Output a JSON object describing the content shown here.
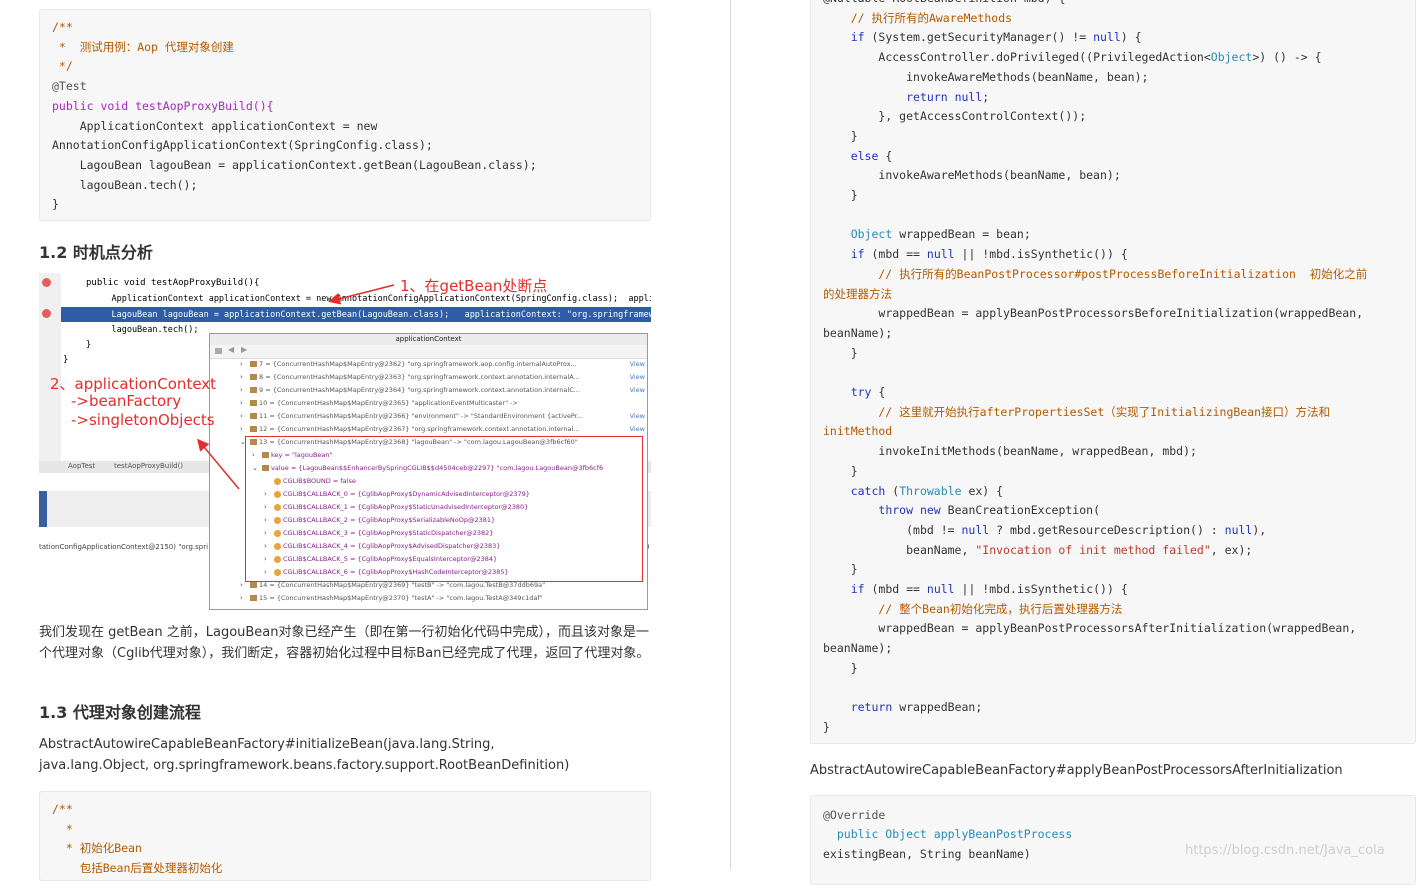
{
  "left": {
    "code1": {
      "lines": [
        "/**",
        " *  测试用例：Aop 代理对象创建",
        " */",
        "@Test",
        "public void testAopProxyBuild(){",
        "    ApplicationContext applicationContext = new",
        "AnnotationConfigApplicationContext(SpringConfig.class);",
        "    LagouBean lagouBean = applicationContext.getBean(LagouBean.class);",
        "    lagouBean.tech();",
        "}"
      ]
    },
    "heading1": "1.2 时机点分析",
    "figure": {
      "ide_lines": [
        "public void testAopProxyBuild(){",
        "    ApplicationContext applicationContext = new AnnotationConfigApplicationContext(SpringConfig.class);  applica",
        "    LagouBean lagouBean = applicationContext.getBean(LagouBean.class);   applicationContext: \"org.springframework",
        "    lagouBean.tech();",
        "  }",
        "}"
      ],
      "status_left": "AopTest",
      "status_right": "testAopProxyBuild()",
      "bottom_text": "tationConfigApplicationContext@2150) \"org.spri",
      "bottom_right": "0",
      "debug_title": "applicationContext",
      "debug_rows": [
        {
          "text": "7 = {ConcurrentHashMap$MapEntry@2362} \"org.springframework.aop.config.internalAutoProx...",
          "view": "View",
          "indent": 0,
          "arrow": ">"
        },
        {
          "text": "8 = {ConcurrentHashMap$MapEntry@2363} \"org.springframework.context.annotation.internalA...",
          "view": "View",
          "indent": 0,
          "arrow": ">"
        },
        {
          "text": "9 = {ConcurrentHashMap$MapEntry@2364} \"org.springframework.context.annotation.internalC...",
          "view": "View",
          "indent": 0,
          "arrow": ">"
        },
        {
          "text": "10 = {ConcurrentHashMap$MapEntry@2365} \"applicationEventMulticaster\" ->",
          "view": "",
          "indent": 0,
          "arrow": ">"
        },
        {
          "text": "11 = {ConcurrentHashMap$MapEntry@2366} \"environment\" -> \"StandardEnvironment {activePr...",
          "view": "View",
          "indent": 0,
          "arrow": ">"
        },
        {
          "text": "12 = {ConcurrentHashMap$MapEntry@2367} \"org.springframework.context.annotation.internal...",
          "view": "View",
          "indent": 0,
          "arrow": ">"
        },
        {
          "text": "13 = {ConcurrentHashMap$MapEntry@2368} \"lagouBean\" -> \"com.lagou.LagouBean@3fb6cf60\"",
          "view": "",
          "indent": 0,
          "arrow": "v"
        },
        {
          "text": "key = \"lagouBean\"",
          "view": "",
          "indent": 1,
          "arrow": ">"
        },
        {
          "text": "value = {LagouBean$$EnhancerBySpringCGLIB$$d4504ceb@2297} \"com.lagou.LagouBean@3fb6cf6",
          "view": "",
          "indent": 1,
          "arrow": "v"
        },
        {
          "text": "CGLIB$BOUND = false",
          "view": "",
          "indent": 2,
          "arrow": ""
        },
        {
          "text": "CGLIB$CALLBACK_0 = {CglibAopProxy$DynamicAdvisedInterceptor@2379}",
          "view": "",
          "indent": 2,
          "arrow": ">"
        },
        {
          "text": "CGLIB$CALLBACK_1 = {CglibAopProxy$StaticUnadvisedInterceptor@2380}",
          "view": "",
          "indent": 2,
          "arrow": ">"
        },
        {
          "text": "CGLIB$CALLBACK_2 = {CglibAopProxy$SerializableNoOp@2381}",
          "view": "",
          "indent": 2,
          "arrow": ">"
        },
        {
          "text": "CGLIB$CALLBACK_3 = {CglibAopProxy$StaticDispatcher@2382}",
          "view": "",
          "indent": 2,
          "arrow": ">"
        },
        {
          "text": "CGLIB$CALLBACK_4 = {CglibAopProxy$AdvisedDispatcher@2383}",
          "view": "",
          "indent": 2,
          "arrow": ">"
        },
        {
          "text": "CGLIB$CALLBACK_5 = {CglibAopProxy$EqualsInterceptor@2384}",
          "view": "",
          "indent": 2,
          "arrow": ">"
        },
        {
          "text": "CGLIB$CALLBACK_6 = {CglibAopProxy$HashCodeInterceptor@2385}",
          "view": "",
          "indent": 2,
          "arrow": ">"
        },
        {
          "text": "14 = {ConcurrentHashMap$MapEntry@2369} \"testB\" -> \"com.lagou.TestB@37ddb69a\"",
          "view": "",
          "indent": 0,
          "arrow": ">"
        },
        {
          "text": "15 = {ConcurrentHashMap$MapEntry@2370} \"testA\" -> \"com.lagou.TestA@349c1daf\"",
          "view": "",
          "indent": 0,
          "arrow": ">"
        }
      ],
      "annotation1": "1、在getBean处断点",
      "annotation2_lines": [
        "2、applicationContext",
        "->beanFactory",
        "->singletonObjects"
      ]
    },
    "paragraph1": "我们发现在 getBean 之前，LagouBean对象已经产生（即在第一行初始化代码中完成），而且该对象是一个代理对象（Cglib代理对象），我们断定，容器初始化过程中目标Ban已经完成了代理，返回了代理对象。",
    "heading2": "1.3 代理对象创建流程",
    "paragraph2": "AbstractAutowireCapableBeanFactory#initializeBean(java.lang.String, java.lang.Object, org.springframework.beans.factory.support.RootBeanDefinition)",
    "code2": {
      "lines": [
        "/**",
        "  *",
        "  * 初始化Bean",
        "    包括Bean后置处理器初始化"
      ]
    }
  },
  "right": {
    "code1": {
      "lines": [
        "@Nullable RootBeanDefinition mbd) {",
        "    // 执行所有的AwareMethods",
        "    if (System.getSecurityManager() != null) {",
        "        AccessController.doPrivileged((PrivilegedAction<Object>) () -> {",
        "            invokeAwareMethods(beanName, bean);",
        "            return null;",
        "        }, getAccessControlContext());",
        "    }",
        "    else {",
        "        invokeAwareMethods(beanName, bean);",
        "    }",
        "",
        "    Object wrappedBean = bean;",
        "    if (mbd == null || !mbd.isSynthetic()) {",
        "        // 执行所有的BeanPostProcessor#postProcessBeforeInitialization  初始化之前",
        "的处理器方法",
        "        wrappedBean = applyBeanPostProcessorsBeforeInitialization(wrappedBean,",
        "beanName);",
        "    }",
        "",
        "    try {",
        "        // 这里就开始执行afterPropertiesSet（实现了InitializingBean接口）方法和",
        "initMethod",
        "        invokeInitMethods(beanName, wrappedBean, mbd);",
        "    }",
        "    catch (Throwable ex) {",
        "        throw new BeanCreationException(",
        "            (mbd != null ? mbd.getResourceDescription() : null),",
        "            beanName, \"Invocation of init method failed\", ex);",
        "    }",
        "    if (mbd == null || !mbd.isSynthetic()) {",
        "        // 整个Bean初始化完成，执行后置处理器方法",
        "        wrappedBean = applyBeanPostProcessorsAfterInitialization(wrappedBean,",
        "beanName);",
        "    }",
        "",
        "    return wrappedBean;",
        "}"
      ]
    },
    "paragraph1": "AbstractAutowireCapableBeanFactory#applyBeanPostProcessorsAfterInitialization",
    "code2": {
      "lines": [
        "@Override",
        "  public Object applyBeanPostProcess",
        "existingBean, String beanName)"
      ]
    }
  },
  "watermark": "https://blog.csdn.net/Java_cola"
}
